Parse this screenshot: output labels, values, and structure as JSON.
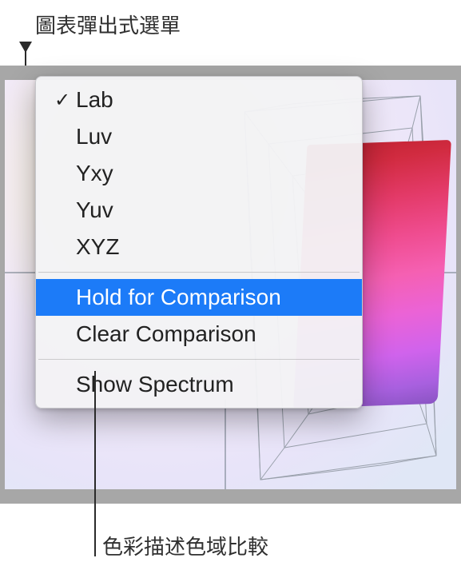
{
  "callouts": {
    "top_label": "圖表彈出式選單",
    "bottom_label": "色彩描述色域比較"
  },
  "menu": {
    "items": [
      {
        "label": "Lab",
        "checked": true
      },
      {
        "label": "Luv",
        "checked": false
      },
      {
        "label": "Yxy",
        "checked": false
      },
      {
        "label": "Yuv",
        "checked": false
      },
      {
        "label": "XYZ",
        "checked": false
      }
    ],
    "group2": [
      {
        "label": "Hold for Comparison",
        "highlight": true
      },
      {
        "label": "Clear Comparison",
        "highlight": false
      }
    ],
    "group3": [
      {
        "label": "Show Spectrum"
      }
    ],
    "checkmark": "✓"
  }
}
